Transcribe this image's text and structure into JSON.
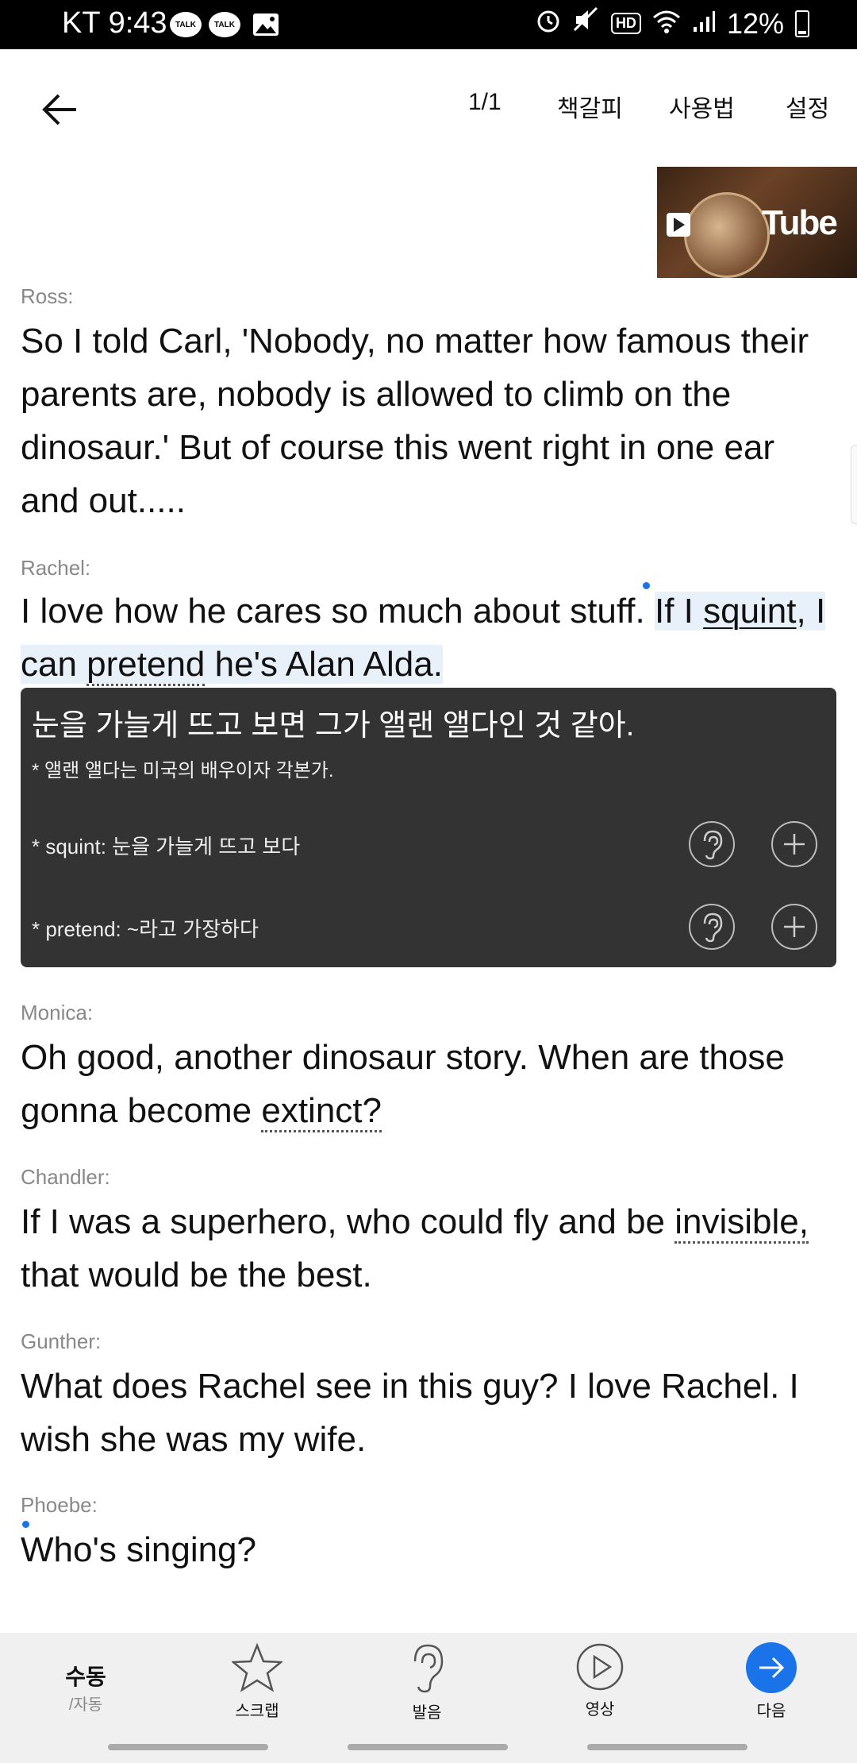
{
  "status": {
    "carrier": "KT",
    "time": "9:43",
    "talk_label": "TALK",
    "hd_label": "HD",
    "battery": "12%"
  },
  "topbar": {
    "page_indicator": "1/1",
    "bookmark_label": "책갈피",
    "howto_label": "사용법",
    "settings_label": "설정"
  },
  "thumbnail": {
    "brand_text": "Tube"
  },
  "dialogue": [
    {
      "speaker": "Ross:",
      "text": "So I told Carl, 'Nobody, no matter how famous their parents are, nobody is allowed to climb on the dinosaur.' But of course this went right in one ear and out....."
    },
    {
      "speaker": "Rachel:",
      "text_a": "I love how he cares so much about stuff. ",
      "text_b": "If I ",
      "text_c": "squint",
      "text_d": ", I can ",
      "text_e": "pretend",
      "text_f": " he's Alan Alda."
    },
    {
      "speaker": "Monica:",
      "text_a": "Oh good, another dinosaur story. When are those gonna become ",
      "text_b": "extinct?"
    },
    {
      "speaker": "Chandler:",
      "text_a": "If I was a superhero, who could fly and be ",
      "text_b": "invisible,",
      "text_c": " that would be the best."
    },
    {
      "speaker": "Gunther:",
      "text": "What does Rachel see in this guy? I love Rachel. I wish she was my wife."
    },
    {
      "speaker": "Phoebe:",
      "text": "Who's singing?"
    }
  ],
  "popup": {
    "translation": "눈을 가늘게 뜨고 보면 그가 앨랜 앨다인 것 같아.",
    "note": "* 앨랜 앨다는 미국의 배우이자 각본가.",
    "vocab": [
      {
        "text": "* squint: 눈을 가늘게 뜨고 보다"
      },
      {
        "text": "* pretend: ~라고 가장하다"
      }
    ]
  },
  "bottomnav": {
    "mode_main": "수동",
    "mode_sub": "/자동",
    "scrap_label": "스크랩",
    "pronounce_label": "발음",
    "video_label": "영상",
    "next_label": "다음"
  },
  "colors": {
    "accent": "#1a73e8",
    "popup_bg": "#333333",
    "highlight": "#e8f1fa",
    "nav_bg": "#f0f0f0"
  }
}
